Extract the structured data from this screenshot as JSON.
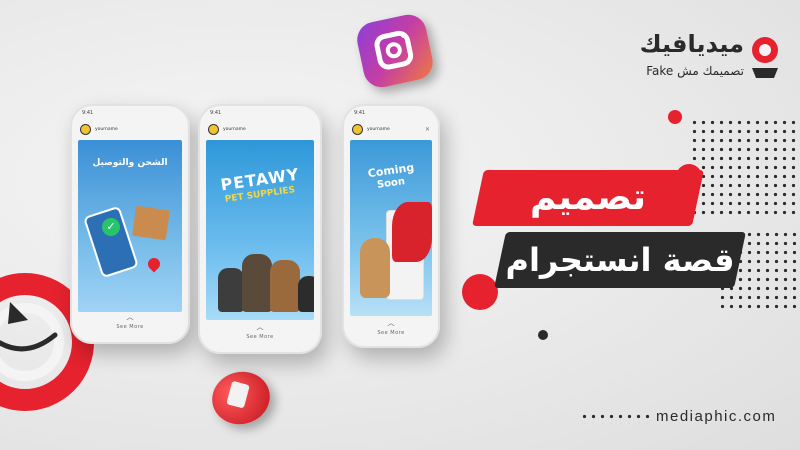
{
  "brand": {
    "name": "ميديافيك",
    "tagline": "تصميمك مش Fake"
  },
  "banner": {
    "line1": "تصميم",
    "line2": "قصة انستجرام"
  },
  "footer": {
    "website": "mediaphic.com"
  },
  "phones": [
    {
      "username": "yourname",
      "see_more": "See More",
      "story_text": "الشحن والتوصيل",
      "story_colors": [
        "#3a8fd6",
        "#9fd3f5"
      ]
    },
    {
      "username": "yourname",
      "see_more": "See More",
      "story_title": "PETAWY",
      "story_subtitle": "PET SUPPLIES",
      "story_colors": [
        "#2e97d8",
        "#a7dcf7"
      ]
    },
    {
      "username": "yourname",
      "see_more": "See More",
      "story_title": "Coming",
      "story_subtitle": "Soon",
      "story_colors": [
        "#3b99d8",
        "#b7e0f6"
      ]
    }
  ],
  "colors": {
    "accent_red": "#e5222e",
    "dark": "#2a2a2a"
  }
}
